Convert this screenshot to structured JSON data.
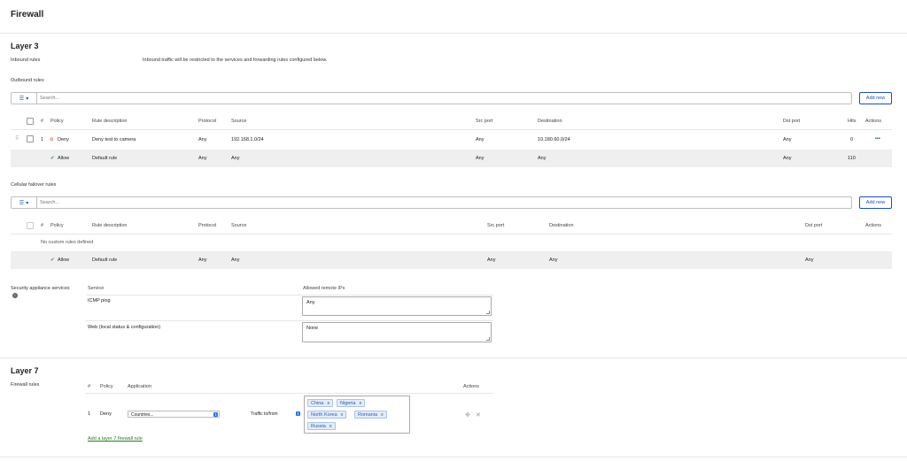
{
  "page": {
    "title": "Firewall"
  },
  "layer3": {
    "title": "Layer 3",
    "inbound_label": "Inbound rules",
    "inbound_text": "Inbound traffic will be restricted to the services and forwarding rules configured below.",
    "outbound": {
      "label": "Outbound rules",
      "search_placeholder": "Search...",
      "add_new": "Add new",
      "headers": {
        "num": "#",
        "policy": "Policy",
        "desc": "Rule description",
        "protocol": "Protocol",
        "source": "Source",
        "src_port": "Src port",
        "destination": "Destination",
        "dst_port": "Dst port",
        "hits": "Hits",
        "actions": "Actions"
      },
      "rows": [
        {
          "num": "1",
          "policy": "Deny",
          "desc": "Deny test to camera",
          "protocol": "Any",
          "source": "192.168.1.0/24",
          "src_port": "Any",
          "destination": "10.180.60.0/24",
          "dst_port": "Any",
          "hits": "0",
          "actions": "•••"
        }
      ],
      "default": {
        "policy": "Allow",
        "desc": "Default rule",
        "protocol": "Any",
        "source": "Any",
        "src_port": "Any",
        "destination": "Any",
        "dst_port": "Any",
        "hits": "110"
      }
    },
    "cellular": {
      "label": "Cellular failover rules",
      "search_placeholder": "Search...",
      "add_new": "Add new",
      "headers": {
        "num": "#",
        "policy": "Policy",
        "desc": "Rule description",
        "protocol": "Protocol",
        "source": "Source",
        "src_port": "Src port",
        "destination": "Destination",
        "dst_port": "Dst port",
        "actions": "Actions"
      },
      "empty_text": "No custom rules defined",
      "default": {
        "policy": "Allow",
        "desc": "Default rule",
        "protocol": "Any",
        "source": "Any",
        "src_port": "Any",
        "destination": "Any",
        "dst_port": "Any"
      }
    },
    "services": {
      "label": "Security appliance services",
      "headers": {
        "service": "Service",
        "allowed": "Allowed remote IPs"
      },
      "rows": [
        {
          "service": "ICMP ping",
          "allowed": "Any"
        },
        {
          "service": "Web (local status & configuration)",
          "allowed": "None"
        }
      ]
    }
  },
  "layer7": {
    "title": "Layer 7",
    "rules_label": "Firewall rules",
    "headers": {
      "num": "#",
      "policy": "Policy",
      "application": "Application",
      "actions": "Actions"
    },
    "rule": {
      "num": "1",
      "policy": "Deny",
      "application": "Countries...",
      "traffic": "Traffic to/from",
      "countries": [
        "China",
        "Nigeria",
        "North Korea",
        "Romania",
        "Russia"
      ]
    },
    "add_link": "Add a layer 7 firewall rule"
  },
  "colors": {
    "accent": "#1d4fb8",
    "deny": "#d0342c",
    "allow": "#2a9a2a",
    "link": "#2a7a1f"
  }
}
